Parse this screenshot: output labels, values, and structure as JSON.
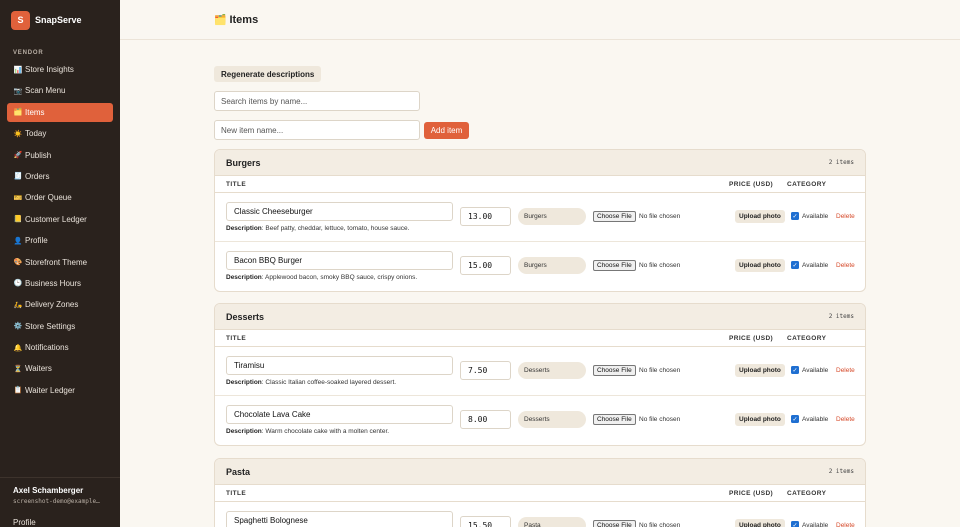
{
  "brand": {
    "logo_letter": "S",
    "name": "SnapServe"
  },
  "sidebar": {
    "section_label": "VENDOR",
    "items": [
      {
        "icon": "📊",
        "label": "Store Insights",
        "active": false
      },
      {
        "icon": "📷",
        "label": "Scan Menu",
        "active": false
      },
      {
        "icon": "🗂️",
        "label": "Items",
        "active": true
      },
      {
        "icon": "☀️",
        "label": "Today",
        "active": false
      },
      {
        "icon": "🚀",
        "label": "Publish",
        "active": false
      },
      {
        "icon": "🧾",
        "label": "Orders",
        "active": false
      },
      {
        "icon": "🎫",
        "label": "Order Queue",
        "active": false
      },
      {
        "icon": "📒",
        "label": "Customer Ledger",
        "active": false
      },
      {
        "icon": "👤",
        "label": "Profile",
        "active": false
      },
      {
        "icon": "🎨",
        "label": "Storefront Theme",
        "active": false
      },
      {
        "icon": "🕒",
        "label": "Business Hours",
        "active": false
      },
      {
        "icon": "🛵",
        "label": "Delivery Zones",
        "active": false
      },
      {
        "icon": "⚙️",
        "label": "Store Settings",
        "active": false
      },
      {
        "icon": "🔔",
        "label": "Notifications",
        "active": false
      },
      {
        "icon": "⏳",
        "label": "Waiters",
        "active": false
      },
      {
        "icon": "📋",
        "label": "Waiter Ledger",
        "active": false
      }
    ],
    "footer": {
      "user_name": "Axel Schamberger",
      "user_email": "screenshot-demo@example…",
      "profile_link": "Profile"
    }
  },
  "header": {
    "icon": "🗂️",
    "title": "Items"
  },
  "toolbar": {
    "regenerate_label": "Regenerate descriptions",
    "search_placeholder": "Search items by name...",
    "new_item_placeholder": "New item name...",
    "add_label": "Add item"
  },
  "columns": {
    "title": "TITLE",
    "price": "PRICE (USD)",
    "category": "CATEGORY"
  },
  "row_labels": {
    "description_prefix": "Description",
    "choose_file": "Choose File",
    "no_file": "No file chosen",
    "upload_photo": "Upload photo",
    "available": "Available",
    "delete": "Delete",
    "check_mark": "✓"
  },
  "categories": [
    {
      "name": "Burgers",
      "count": "2 items",
      "items": [
        {
          "title": "Classic Cheeseburger",
          "price": "13.00",
          "category": "Burgers",
          "description": "Beef patty, cheddar, lettuce, tomato, house sauce.",
          "available": true
        },
        {
          "title": "Bacon BBQ Burger",
          "price": "15.00",
          "category": "Burgers",
          "description": "Applewood bacon, smoky BBQ sauce, crispy onions.",
          "available": true
        }
      ]
    },
    {
      "name": "Desserts",
      "count": "2 items",
      "items": [
        {
          "title": "Tiramisu",
          "price": "7.50",
          "category": "Desserts",
          "description": "Classic Italian coffee-soaked layered dessert.",
          "available": true
        },
        {
          "title": "Chocolate Lava Cake",
          "price": "8.00",
          "category": "Desserts",
          "description": "Warm chocolate cake with a molten center.",
          "available": true
        }
      ]
    },
    {
      "name": "Pasta",
      "count": "2 items",
      "items": [
        {
          "title": "Spaghetti Bolognese",
          "price": "15.50",
          "category": "Pasta",
          "description": "",
          "available": true
        }
      ]
    }
  ],
  "colors": {
    "accent": "#e0613b",
    "sidebar_bg": "#2a221d",
    "page_bg": "#faf7f1",
    "checkbox": "#1f6fd1",
    "delete": "#d64a2a"
  }
}
